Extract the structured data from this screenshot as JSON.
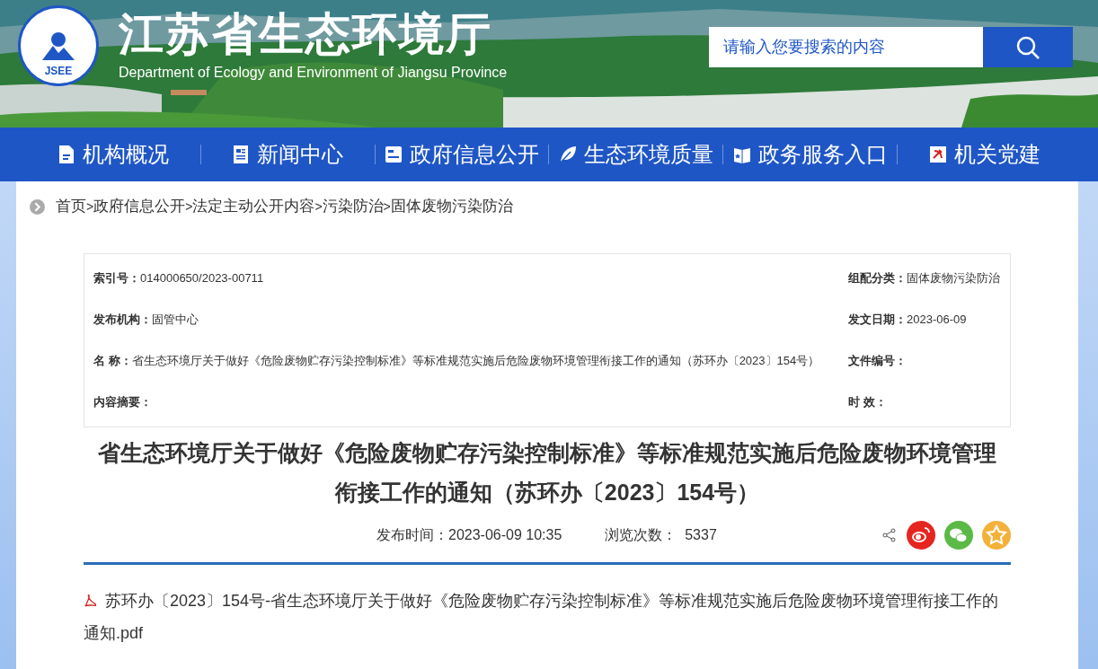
{
  "header": {
    "logo_text": "JSEE",
    "title": "江苏省生态环境厅",
    "subtitle": "Department of Ecology and Environment of Jiangsu Province",
    "search": {
      "placeholder": "请输入您要搜索的内容"
    }
  },
  "nav": [
    {
      "label": "机构概况",
      "kind": "doc"
    },
    {
      "label": "新闻中心",
      "kind": "news"
    },
    {
      "label": "政府信息公开",
      "kind": "card"
    },
    {
      "label": "生态环境质量",
      "kind": "leaf"
    },
    {
      "label": "政务服务入口",
      "kind": "book"
    },
    {
      "label": "机关党建",
      "kind": "party"
    }
  ],
  "breadcrumb": {
    "separator": ">",
    "items": [
      "首页",
      "政府信息公开",
      "法定主动公开内容",
      "污染防治",
      "固体废物污染防治"
    ]
  },
  "meta": [
    {
      "label": "索引号：",
      "value": "014000650/2023-00711",
      "right_label": "组配分类：",
      "right_value": "固体废物污染防治"
    },
    {
      "label": "发布机构：",
      "value": "固管中心",
      "right_label": "发文日期：",
      "right_value": "2023-06-09"
    },
    {
      "label": "名 称：",
      "value": "省生态环境厅关于做好《危险废物贮存污染控制标准》等标准规范实施后危险废物环境管理衔接工作的通知（苏环办〔2023〕154号）",
      "right_label": "文件编号："
    },
    {
      "label": "内容摘要：",
      "right_label": "时 效："
    }
  ],
  "article": {
    "title": "省生态环境厅关于做好《危险废物贮存污染控制标准》等标准规范实施后危险废物环境管理衔接工作的通知（苏环办〔2023〕154号）",
    "publish_time": "发布时间：2023-06-09 10:35",
    "views": "浏览次数：  5337",
    "share": [
      {
        "kind": "share"
      },
      {
        "kind": "weibo",
        "color": "#e6251f"
      },
      {
        "kind": "wechat",
        "color": "#5bb946"
      },
      {
        "kind": "qzone",
        "color": "#f4b13a"
      }
    ],
    "attachment": "苏环办〔2023〕154号-省生态环境厅关于做好《危险废物贮存污染控制标准》等标准规范实施后危险废物环境管理衔接工作的通知.pdf"
  }
}
